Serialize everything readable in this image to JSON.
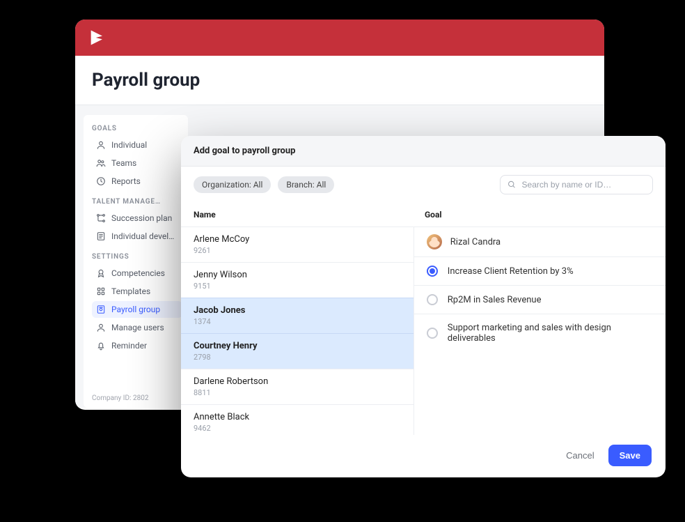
{
  "header": {
    "title": "Payroll group"
  },
  "sidebar": {
    "groups": [
      {
        "label": "GOALS",
        "items": [
          {
            "icon": "user-icon",
            "label": "Individual",
            "active": false
          },
          {
            "icon": "users-icon",
            "label": "Teams",
            "active": false
          },
          {
            "icon": "clock-icon",
            "label": "Reports",
            "active": false
          }
        ]
      },
      {
        "label": "TALENT MANAGE…",
        "items": [
          {
            "icon": "path-icon",
            "label": "Succession plan",
            "active": false
          },
          {
            "icon": "note-icon",
            "label": "Individual develop…",
            "active": false
          }
        ]
      },
      {
        "label": "SETTINGS",
        "items": [
          {
            "icon": "badge-icon",
            "label": "Competencies",
            "active": false
          },
          {
            "icon": "grid-icon",
            "label": "Templates",
            "active": false
          },
          {
            "icon": "payroll-icon",
            "label": "Payroll group",
            "active": true
          },
          {
            "icon": "user2-icon",
            "label": "Manage users",
            "active": false
          },
          {
            "icon": "bell-icon",
            "label": "Reminder",
            "active": false
          }
        ]
      }
    ],
    "company_id": "Company ID: 2802"
  },
  "dialog": {
    "title": "Add goal to payroll group",
    "filters": {
      "org": "Organization: All",
      "branch": "Branch: All"
    },
    "search_placeholder": "Search by name or ID…",
    "columns": {
      "name": "Name",
      "goal": "Goal"
    },
    "people": [
      {
        "name": "Arlene McCoy",
        "id": "9261",
        "selected": false
      },
      {
        "name": "Jenny Wilson",
        "id": "9151",
        "selected": false
      },
      {
        "name": "Jacob Jones",
        "id": "1374",
        "selected": true
      },
      {
        "name": "Courtney Henry",
        "id": "2798",
        "selected": true
      },
      {
        "name": "Darlene Robertson",
        "id": "8811",
        "selected": false
      },
      {
        "name": "Annette Black",
        "id": "9462",
        "selected": false
      }
    ],
    "owner": {
      "name": "Rizal Candra"
    },
    "goals": [
      {
        "label": "Increase Client Retention by 3%",
        "selected": true
      },
      {
        "label": "Rp2M in Sales Revenue",
        "selected": false
      },
      {
        "label": "Support marketing and sales with design deliverables",
        "selected": false
      }
    ],
    "actions": {
      "cancel": "Cancel",
      "save": "Save"
    }
  }
}
